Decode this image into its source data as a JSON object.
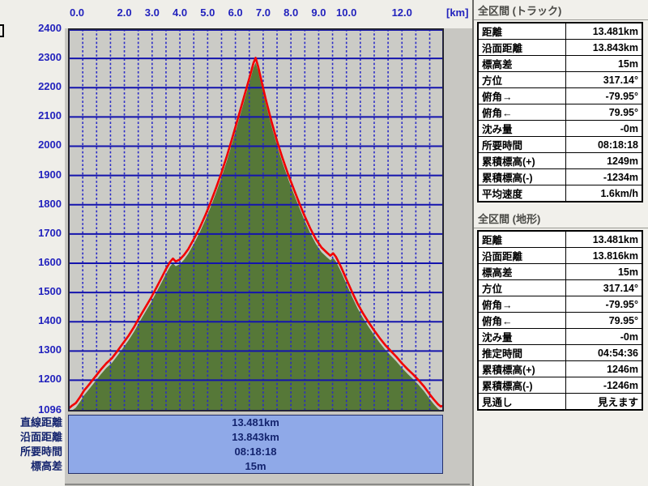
{
  "window": {
    "kind": "elevation-profile-pane"
  },
  "colors": {
    "axis_label_blue": "#2222bd",
    "grid_blue": "#1414ad",
    "grid_dash_blue": "#2a2ac8",
    "red_track_line": "#f20000",
    "terrain_green": "#567838",
    "chart_bg": "#cbcbc6",
    "summary_fill": "#8fa9e8",
    "summary_text": "#14246e",
    "panel_light": "#efeee9",
    "panel_gray": "#c8c7c2"
  },
  "chart_data": {
    "type": "area",
    "title": "",
    "xlabel_unit": "[km]",
    "x_min": 0,
    "x_max": 13.481,
    "y_min": 1096,
    "y_max": 2400,
    "grid": true,
    "x_tick_labels": [
      {
        "km": 0,
        "label": "0.0"
      },
      {
        "km": 2,
        "label": "2.0"
      },
      {
        "km": 3,
        "label": "3.0"
      },
      {
        "km": 4,
        "label": "4.0"
      },
      {
        "km": 5,
        "label": "5.0"
      },
      {
        "km": 6,
        "label": "6.0"
      },
      {
        "km": 7,
        "label": "7.0"
      },
      {
        "km": 8,
        "label": "8.0"
      },
      {
        "km": 9,
        "label": "9.0"
      },
      {
        "km": 10,
        "label": "10.0"
      },
      {
        "km": 12,
        "label": "12.0"
      }
    ],
    "y_tick_labels": [
      2400,
      2300,
      2200,
      2100,
      2000,
      1900,
      1800,
      1700,
      1600,
      1500,
      1400,
      1300,
      1200,
      1096
    ],
    "h_gridlines_every_m": 100,
    "v_gridlines_every_km": 0.5,
    "series": [
      {
        "name": "track-elevation-red-line",
        "points_km_m": [
          [
            0.0,
            1104
          ],
          [
            0.1,
            1112
          ],
          [
            0.25,
            1122
          ],
          [
            0.4,
            1142
          ],
          [
            0.55,
            1165
          ],
          [
            0.7,
            1182
          ],
          [
            0.85,
            1200
          ],
          [
            1.0,
            1218
          ],
          [
            1.15,
            1236
          ],
          [
            1.35,
            1258
          ],
          [
            1.55,
            1275
          ],
          [
            1.75,
            1300
          ],
          [
            1.95,
            1326
          ],
          [
            2.15,
            1352
          ],
          [
            2.35,
            1382
          ],
          [
            2.55,
            1416
          ],
          [
            2.75,
            1448
          ],
          [
            2.95,
            1480
          ],
          [
            3.15,
            1516
          ],
          [
            3.35,
            1552
          ],
          [
            3.5,
            1580
          ],
          [
            3.65,
            1605
          ],
          [
            3.75,
            1616
          ],
          [
            3.85,
            1606
          ],
          [
            4.0,
            1613
          ],
          [
            4.15,
            1628
          ],
          [
            4.3,
            1648
          ],
          [
            4.5,
            1682
          ],
          [
            4.7,
            1718
          ],
          [
            4.9,
            1760
          ],
          [
            5.1,
            1806
          ],
          [
            5.3,
            1856
          ],
          [
            5.5,
            1910
          ],
          [
            5.7,
            1968
          ],
          [
            5.9,
            2032
          ],
          [
            6.1,
            2098
          ],
          [
            6.3,
            2165
          ],
          [
            6.5,
            2232
          ],
          [
            6.65,
            2284
          ],
          [
            6.73,
            2302
          ],
          [
            6.82,
            2272
          ],
          [
            6.95,
            2218
          ],
          [
            7.1,
            2158
          ],
          [
            7.3,
            2084
          ],
          [
            7.5,
            2018
          ],
          [
            7.7,
            1958
          ],
          [
            7.9,
            1904
          ],
          [
            8.1,
            1854
          ],
          [
            8.3,
            1806
          ],
          [
            8.5,
            1760
          ],
          [
            8.7,
            1718
          ],
          [
            8.9,
            1682
          ],
          [
            9.1,
            1654
          ],
          [
            9.3,
            1636
          ],
          [
            9.42,
            1626
          ],
          [
            9.52,
            1634
          ],
          [
            9.62,
            1622
          ],
          [
            9.8,
            1588
          ],
          [
            10.0,
            1545
          ],
          [
            10.2,
            1502
          ],
          [
            10.4,
            1462
          ],
          [
            10.6,
            1428
          ],
          [
            10.8,
            1398
          ],
          [
            11.0,
            1370
          ],
          [
            11.2,
            1344
          ],
          [
            11.4,
            1320
          ],
          [
            11.6,
            1300
          ],
          [
            11.8,
            1280
          ],
          [
            12.0,
            1258
          ],
          [
            12.2,
            1238
          ],
          [
            12.4,
            1220
          ],
          [
            12.6,
            1200
          ],
          [
            12.8,
            1178
          ],
          [
            13.0,
            1152
          ],
          [
            13.15,
            1134
          ],
          [
            13.3,
            1118
          ],
          [
            13.4,
            1110
          ],
          [
            13.48,
            1113
          ]
        ]
      },
      {
        "name": "terrain-green-fill",
        "derived_from": "track-elevation-red-line",
        "offset_m": -16
      }
    ]
  },
  "summary": {
    "rows": [
      {
        "label": "直線距離",
        "value": "13.481km"
      },
      {
        "label": "沿面距離",
        "value": "13.843km"
      },
      {
        "label": "所要時間",
        "value": "08:18:18"
      },
      {
        "label": "標高差",
        "value": "15m"
      }
    ]
  },
  "panels": [
    {
      "title": "全区間 (トラック)",
      "rows": [
        {
          "label": "距離",
          "value": "13.481km"
        },
        {
          "label": "沿面距離",
          "value": "13.843km"
        },
        {
          "label": "標高差",
          "value": "15m"
        },
        {
          "label": "方位",
          "value": "317.14°"
        },
        {
          "label": "俯角→",
          "value": "-79.95°"
        },
        {
          "label": "俯角←",
          "value": "79.95°"
        },
        {
          "label": "沈み量",
          "value": "-0m"
        },
        {
          "label": "所要時間",
          "value": "08:18:18"
        },
        {
          "label": "累積標高(+)",
          "value": "1249m"
        },
        {
          "label": "累積標高(-)",
          "value": "-1234m"
        },
        {
          "label": "平均速度",
          "value": "1.6km/h"
        }
      ]
    },
    {
      "title": "全区間 (地形)",
      "rows": [
        {
          "label": "距離",
          "value": "13.481km"
        },
        {
          "label": "沿面距離",
          "value": "13.816km"
        },
        {
          "label": "標高差",
          "value": "15m"
        },
        {
          "label": "方位",
          "value": "317.14°"
        },
        {
          "label": "俯角→",
          "value": "-79.95°"
        },
        {
          "label": "俯角←",
          "value": "79.95°"
        },
        {
          "label": "沈み量",
          "value": "-0m"
        },
        {
          "label": "推定時間",
          "value": "04:54:36"
        },
        {
          "label": "累積標高(+)",
          "value": "1246m"
        },
        {
          "label": "累積標高(-)",
          "value": "-1246m"
        },
        {
          "label": "見通し",
          "value": "見えます"
        }
      ]
    }
  ]
}
